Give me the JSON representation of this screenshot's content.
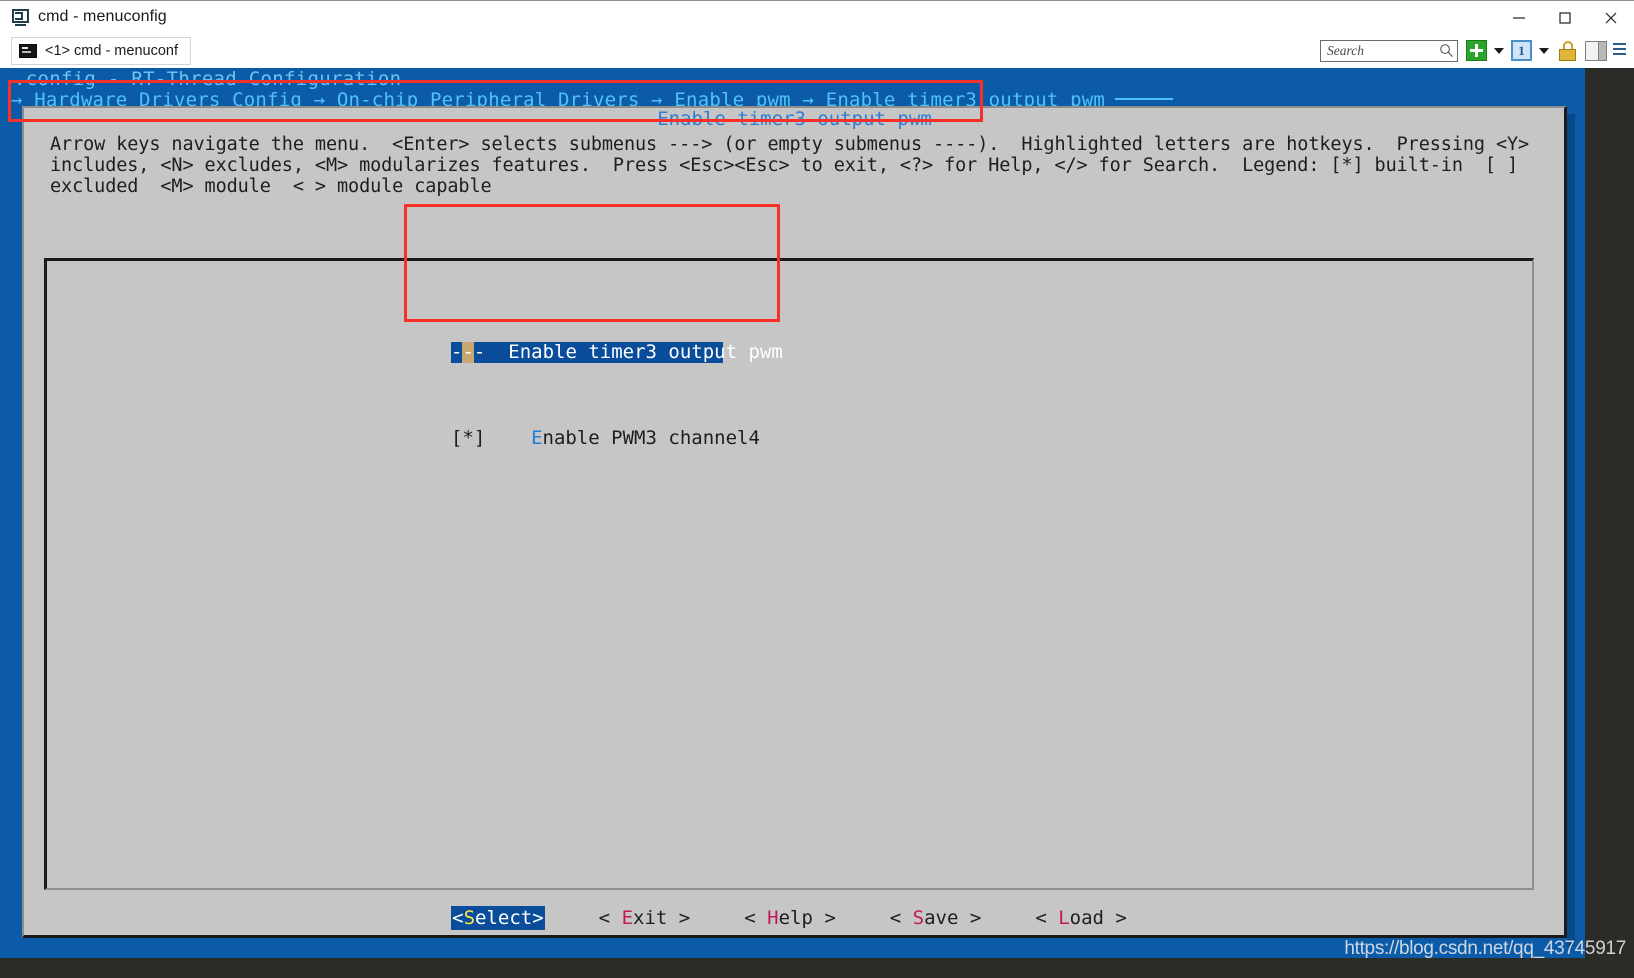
{
  "window": {
    "title": "cmd - menuconfig",
    "icon": "console-window-icon",
    "minimize_label": "–",
    "maximize_label": "□",
    "close_label": "✕"
  },
  "tabbar": {
    "tabs": [
      {
        "label": "<1> cmd - menuconf",
        "icon": "console-icon",
        "active": true
      }
    ]
  },
  "toolbar": {
    "search_placeholder": "Search",
    "search_value": "",
    "icons": [
      "search-icon",
      "green-plus-icon",
      "chevron-down-icon",
      "pane-one-icon",
      "chevron-down-icon",
      "lock-icon",
      "split-panel-icon",
      "hamburger-menu-icon"
    ]
  },
  "terminal": {
    "config_title": ".config - RT-Thread Configuration",
    "breadcrumb": "→ Hardware Drivers Config → On-chip Peripheral Drivers → Enable pwm → Enable timer3 output pwm",
    "breadcrumb_parts": [
      "Hardware Drivers Config",
      "On-chip Peripheral Drivers",
      "Enable pwm",
      "Enable timer3 output pwm"
    ],
    "dialog_title": "Enable timer3 output pwm",
    "help_text": "Arrow keys navigate the menu.  <Enter> selects submenus ---> (or empty submenus ----).  Highlighted letters are hotkeys.  Pressing <Y> includes, <N> excludes, <M> modularizes features.  Press <Esc><Esc> to exit, <?> for Help, </> for Search.  Legend: [*] built-in  [ ] excluded  <M> module  < > module capable",
    "menu_items": [
      {
        "prefix_before": "-",
        "cursor_char": "-",
        "prefix_after": "-",
        "label": "Enable timer3 output pwm",
        "selected": true,
        "hotkey": ""
      },
      {
        "prefix": "[*]",
        "hotkey": "E",
        "label_rest": "nable PWM3 channel4",
        "label": "Enable PWM3 channel4",
        "selected": false
      }
    ],
    "buttons": [
      {
        "label": "<Select>",
        "hotkey": "S",
        "active": true,
        "before": "<",
        "after": "elect>"
      },
      {
        "label": "< Exit >",
        "hotkey": "E",
        "active": false,
        "before": "< ",
        "after": "xit >"
      },
      {
        "label": "< Help >",
        "hotkey": "H",
        "active": false,
        "before": "< ",
        "after": "elp >"
      },
      {
        "label": "< Save >",
        "hotkey": "S",
        "active": false,
        "before": "< ",
        "after": "ave >"
      },
      {
        "label": "< Load >",
        "hotkey": "L",
        "active": false,
        "before": "< ",
        "after": "oad >"
      }
    ]
  },
  "watermark": {
    "text": "https://blog.csdn.net/qq_43745917"
  },
  "annotations": [
    {
      "name": "breadcrumb-highlight",
      "color": "#f8302a"
    },
    {
      "name": "menu-items-highlight",
      "color": "#f8302a"
    }
  ],
  "colors": {
    "terminal_bg": "#0c5ba8",
    "dialog_bg": "#c6c6c6",
    "selection_bg": "#0a4e9b",
    "cursor_bg": "#c8a871",
    "link_text": "#4fc3f7",
    "hotkey": "#c2185b",
    "annotation": "#f8302a"
  }
}
